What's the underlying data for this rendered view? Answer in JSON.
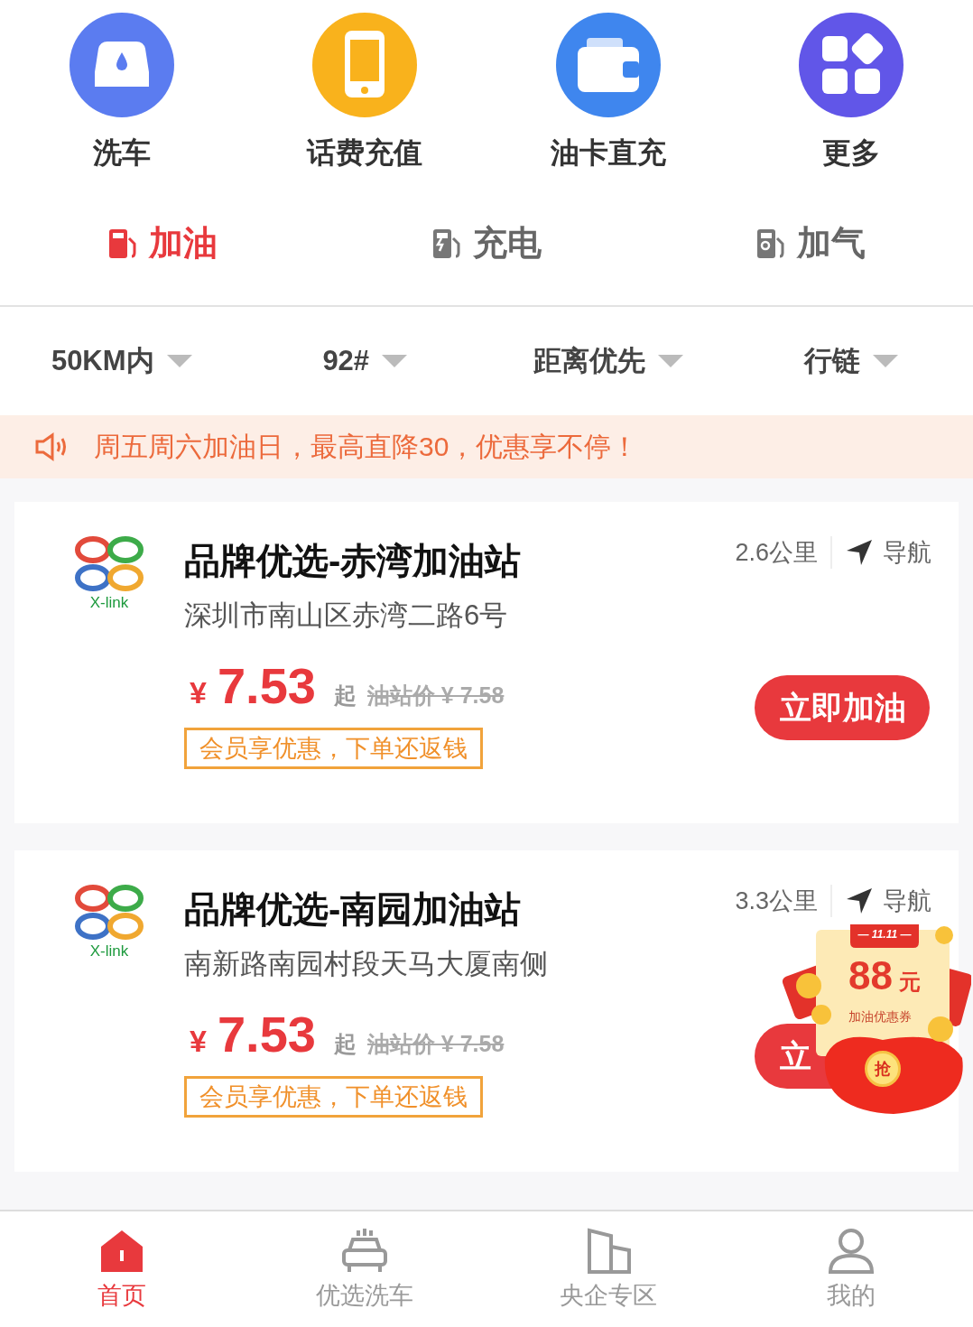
{
  "shortcuts": [
    {
      "kind": "car",
      "label": "洗车",
      "color": "#5b7cf0"
    },
    {
      "kind": "phone",
      "label": "话费充值",
      "color": "#f9b21c"
    },
    {
      "kind": "wallet",
      "label": "油卡直充",
      "color": "#3f86ee"
    },
    {
      "kind": "grid",
      "label": "更多",
      "color": "#6156e8"
    }
  ],
  "fuel_tabs": [
    {
      "kind": "pump",
      "label": "加油",
      "selected": true
    },
    {
      "kind": "charger",
      "label": "充电",
      "selected": false
    },
    {
      "kind": "gas",
      "label": "加气",
      "selected": false
    }
  ],
  "filters": [
    "50KM内",
    "92#",
    "距离优先",
    "行链"
  ],
  "notice": "周五周六加油日，最高直降30，优惠享不停！",
  "stations": [
    {
      "logo_text": "X-link",
      "name": "品牌优选-赤湾加油站",
      "address": "深圳市南山区赤湾二路6号",
      "distance": "2.6公里",
      "nav": "导航",
      "currency": "¥",
      "price": "7.53",
      "price_suffix": "起",
      "list_price": "油站价 ¥ 7.58",
      "promo": "会员享优惠，下单还返钱",
      "button": "立即加油"
    },
    {
      "logo_text": "X-link",
      "name": "品牌优选-南园加油站",
      "address": "南新路南园村段天马大厦南侧",
      "distance": "3.3公里",
      "nav": "导航",
      "currency": "¥",
      "price": "7.53",
      "price_suffix": "起",
      "list_price": "油站价 ¥ 7.58",
      "promo": "会员享优惠，下单还返钱",
      "button": "立"
    }
  ],
  "coupon": {
    "tag": "— 11.11 —",
    "amount": "88",
    "unit": "元",
    "label": "加油优惠券",
    "action": "抢"
  },
  "bottom_nav": [
    {
      "kind": "home",
      "label": "首页",
      "selected": true
    },
    {
      "kind": "car",
      "label": "优选洗车",
      "selected": false
    },
    {
      "kind": "building",
      "label": "央企专区",
      "selected": false
    },
    {
      "kind": "person",
      "label": "我的",
      "selected": false
    }
  ]
}
